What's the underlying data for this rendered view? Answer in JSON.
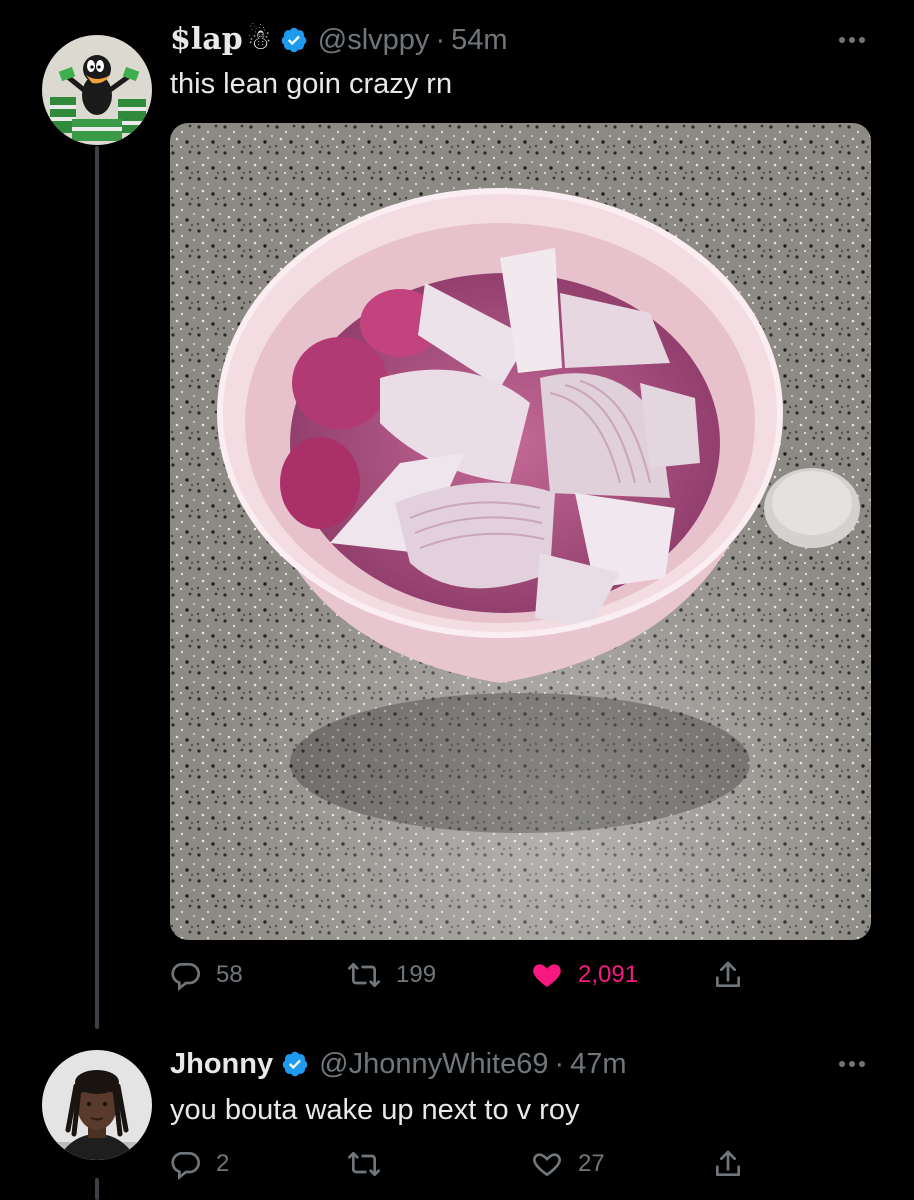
{
  "thread": [
    {
      "author": {
        "display_name": "$lap",
        "emoji": "☃",
        "verified": true,
        "handle": "@slvppy",
        "time": "54m",
        "avatar_icon": "cartoon-duck-avatar"
      },
      "text": "this lean goin crazy rn",
      "media_icon": "bowl-of-onions-photo",
      "actions": {
        "replies": "58",
        "retweets": "199",
        "likes": "2,091",
        "liked": true
      }
    },
    {
      "author": {
        "display_name": "Jhonny",
        "verified": true,
        "handle": "@JhonnyWhite69",
        "time": "47m",
        "avatar_icon": "person-avatar"
      },
      "text": "you bouta wake up next to v roy",
      "actions": {
        "replies": "2",
        "retweets": "",
        "likes": "27",
        "liked": false
      }
    }
  ],
  "colors": {
    "background": "#000000",
    "text": "#e7e9ea",
    "muted": "#71767b",
    "like": "#f91880",
    "verified": "#1d9bf0"
  },
  "separator": "·"
}
